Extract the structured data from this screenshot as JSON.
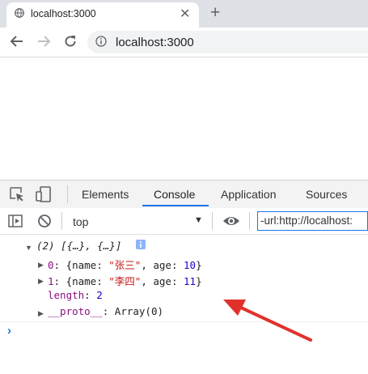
{
  "browser": {
    "tab_title": "localhost:3000",
    "url": "localhost:3000",
    "tab_close": "✕",
    "new_tab": "+"
  },
  "devtools": {
    "tabs": [
      "Elements",
      "Console",
      "Application",
      "Sources"
    ],
    "active_tab": "Console",
    "context": "top",
    "filter_value": "-url:http://localhost:"
  },
  "console": {
    "summary": "(2) [{…}, {…}]",
    "items": [
      {
        "index": "0",
        "name": "\"张三\"",
        "age": "10"
      },
      {
        "index": "1",
        "name": "\"李四\"",
        "age": "11"
      }
    ],
    "length_key": "length",
    "length_value": "2",
    "proto_key": "__proto__",
    "proto_value": "Array(0)"
  },
  "annotation": {
    "arrow_color": "#e0322b"
  }
}
